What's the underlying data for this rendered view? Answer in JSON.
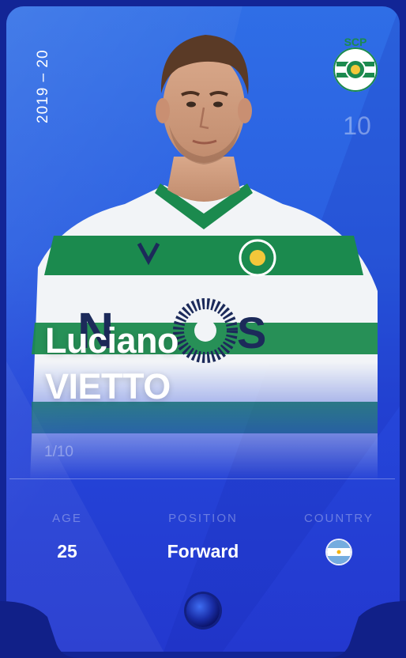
{
  "card": {
    "season": "2019 – 20",
    "jersey_number": "10",
    "first_name": "Luciano",
    "last_name": "VIETTO",
    "serial": "1/10",
    "club_logo": "sporting-cp-crest-icon",
    "stats": {
      "age_label": "AGE",
      "age_value": "25",
      "position_label": "POSITION",
      "position_value": "Forward",
      "country_label": "COUNTRY",
      "country_flag": "argentina-flag-icon"
    },
    "rarity_icon": "rarity-gem-icon"
  },
  "colors": {
    "card_top": "#2f6ee6",
    "card_bottom": "#2338cf",
    "frame": "#122596",
    "club_green": "#1a8a4a"
  }
}
